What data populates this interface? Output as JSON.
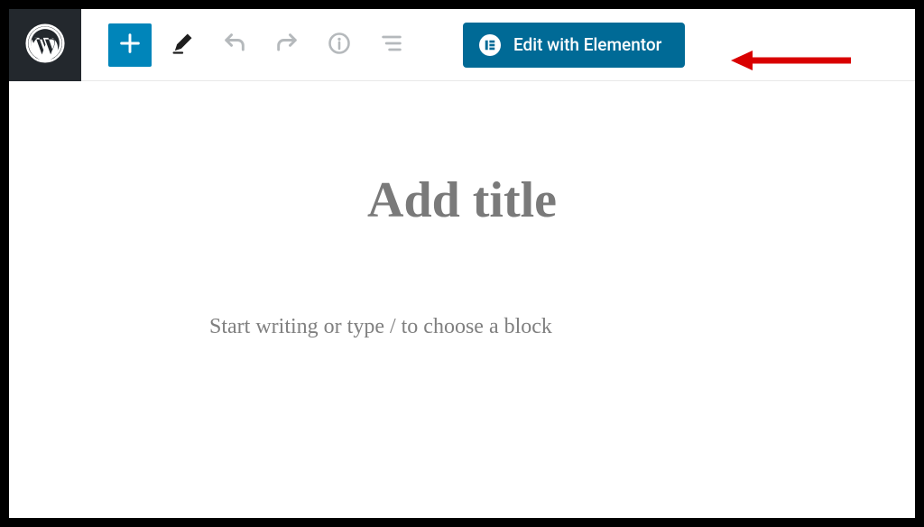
{
  "toolbar": {
    "elementor_label": "Edit with Elementor"
  },
  "editor": {
    "title_placeholder": "Add title",
    "body_placeholder": "Start writing or type / to choose a block"
  },
  "colors": {
    "wp_admin_dark": "#23282d",
    "wp_primary": "#0085ba",
    "elementor_blue": "#006a96",
    "annotation_red": "#d90000"
  }
}
